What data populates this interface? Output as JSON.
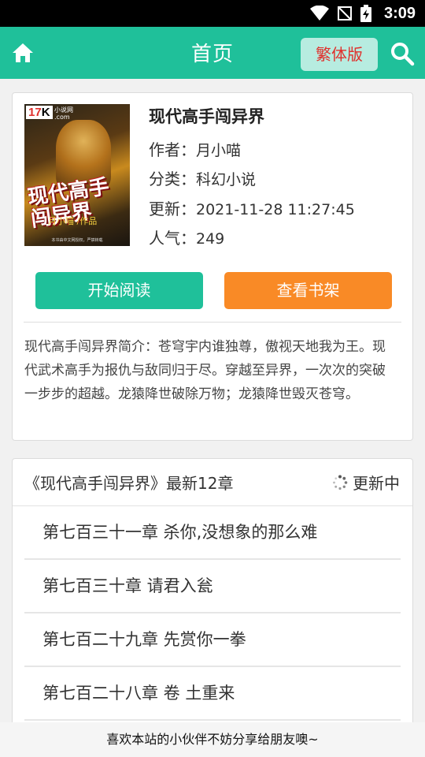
{
  "status": {
    "time": "3:09"
  },
  "header": {
    "title": "首页",
    "traditional_label": "繁体版"
  },
  "book": {
    "cover": {
      "logo_num": "17",
      "logo_letter": "K",
      "site_text": "小说网\n.com",
      "title_text": "现代高手\n闯异界",
      "author_text": "月小喵 /作品",
      "foot_text": "本书由中文网授权，严禁转载"
    },
    "title": "现代高手闯异界",
    "author_key": "作者：",
    "author": "月小喵",
    "category_key": "分类：",
    "category": "科幻小说",
    "updated_key": "更新：",
    "updated": "2021-11-28 11:27:45",
    "popularity_key": "人气：",
    "popularity": "249",
    "read_button": "开始阅读",
    "shelf_button": "查看书架",
    "intro": "现代高手闯异界简介：苍穹宇内谁独尊，傲视天地我为王。现代武术高手为报仇与敌同归于尽。穿越至异界，一次次的突破一步步的超越。龙猿降世破除万物；龙猿降世毁灭苍穹。"
  },
  "chapters": {
    "title": "《现代高手闯异界》最新12章",
    "status": "更新中",
    "items": [
      {
        "label": "第七百三十一章 杀你,没想象的那么难"
      },
      {
        "label": "第七百三十章 请君入瓮"
      },
      {
        "label": "第七百二十九章 先赏你一拳"
      },
      {
        "label": "第七百二十八章 卷 土重来"
      },
      {
        "label": ""
      }
    ]
  },
  "footer": {
    "share_text": "喜欢本站的小伙伴不妨分享给朋友噢~"
  },
  "colors": {
    "accent": "#1fc09a",
    "orange": "#f98a26",
    "red_text": "#e0302c"
  }
}
